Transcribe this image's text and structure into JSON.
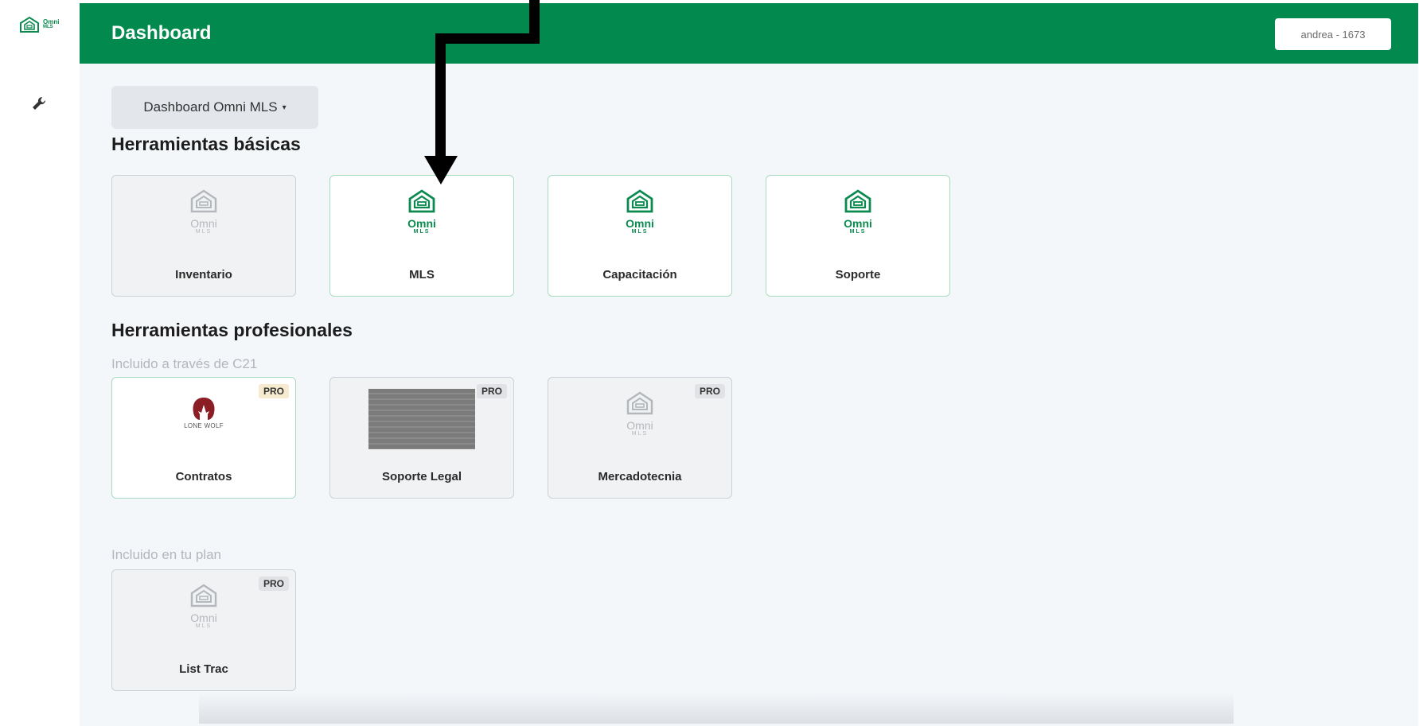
{
  "brand": {
    "logo_omni": "Omni",
    "logo_mls": "MLS"
  },
  "header": {
    "title": "Dashboard",
    "user": "andrea - 1673"
  },
  "dropdown": {
    "label": "Dashboard Omni MLS"
  },
  "basic": {
    "title": "Herramientas básicas",
    "cards": [
      {
        "label": "Inventario",
        "enabled": false
      },
      {
        "label": "MLS",
        "enabled": true
      },
      {
        "label": "Capacitación",
        "enabled": true
      },
      {
        "label": "Soporte",
        "enabled": true
      }
    ]
  },
  "pro": {
    "title": "Herramientas profesionales",
    "subtitle_c21": "Incluido a través de C21",
    "badge": "PRO",
    "cards": [
      {
        "label": "Contratos",
        "logo_text": "LONE WOLF"
      },
      {
        "label": "Soporte Legal"
      },
      {
        "label": "Mercadotecnia"
      }
    ],
    "subtitle_plan": "Incluido en tu plan",
    "plan_cards": [
      {
        "label": "List Trac"
      }
    ]
  },
  "colors": {
    "header_green": "#028a4e",
    "accent_green": "#0b8a4f",
    "lone_wolf_red": "#8b1e24"
  },
  "icons": {
    "wrench": "wrench-icon",
    "house": "omni-house-icon"
  }
}
